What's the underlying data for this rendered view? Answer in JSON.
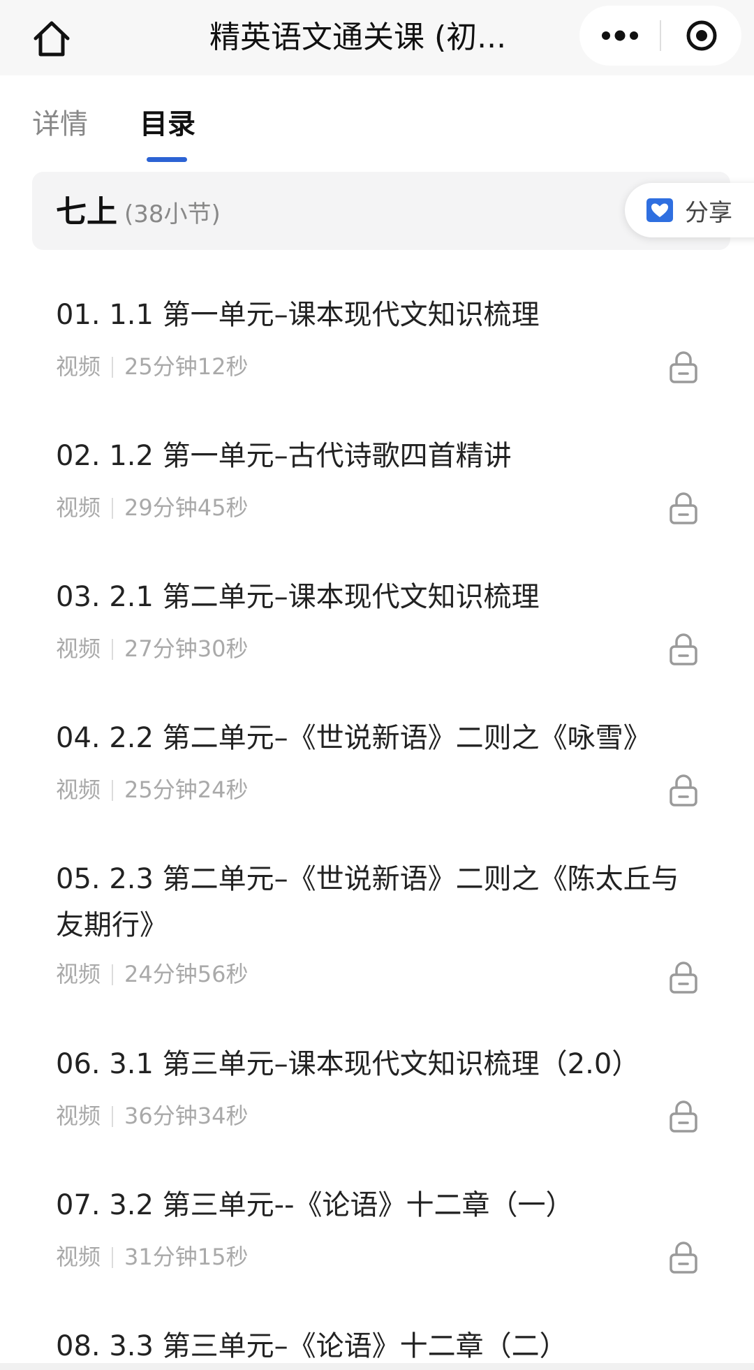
{
  "topbar": {
    "title": "精英语文通关课 (初...",
    "home_icon": "home-icon",
    "more_icon": "more-dots-icon",
    "close_icon": "target-circle-icon"
  },
  "tabs": [
    {
      "label": "详情",
      "active": false
    },
    {
      "label": "目录",
      "active": true
    }
  ],
  "section": {
    "title": "七上",
    "count": "(38小节)"
  },
  "share": {
    "label": "分享",
    "icon": "share-heart-icon"
  },
  "lessons": [
    {
      "title": "01. 1.1 第一单元–课本现代文知识梳理",
      "type": "视频",
      "duration": "25分钟12秒",
      "locked": true
    },
    {
      "title": "02. 1.2 第一单元–古代诗歌四首精讲",
      "type": "视频",
      "duration": "29分钟45秒",
      "locked": true
    },
    {
      "title": "03. 2.1 第二单元–课本现代文知识梳理",
      "type": "视频",
      "duration": "27分钟30秒",
      "locked": true
    },
    {
      "title": "04. 2.2 第二单元–《世说新语》二则之《咏雪》",
      "type": "视频",
      "duration": "25分钟24秒",
      "locked": true
    },
    {
      "title": "05. 2.3 第二单元–《世说新语》二则之《陈太丘与友期行》",
      "type": "视频",
      "duration": "24分钟56秒",
      "locked": true
    },
    {
      "title": "06. 3.1 第三单元–课本现代文知识梳理（2.0）",
      "type": "视频",
      "duration": "36分钟34秒",
      "locked": true
    },
    {
      "title": "07. 3.2 第三单元--《论语》十二章（一）",
      "type": "视频",
      "duration": "31分钟15秒",
      "locked": true
    },
    {
      "title": "08. 3.3 第三单元–《论语》十二章（二）",
      "type": "",
      "duration": "",
      "locked": false
    }
  ],
  "colors": {
    "accent": "#2c63d4",
    "muted_text": "#a9a9a9"
  }
}
